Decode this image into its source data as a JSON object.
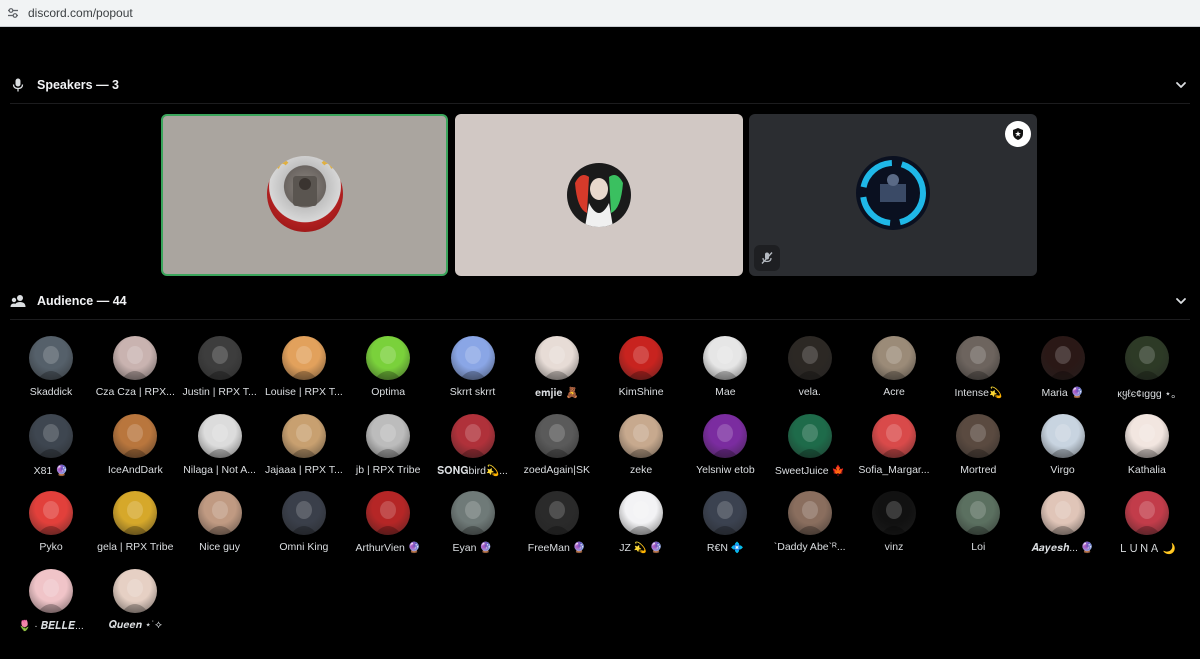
{
  "browser": {
    "url": "discord.com/popout",
    "tune_icon": "site-settings-icon"
  },
  "speakers": {
    "title": "Speakers — 3",
    "icon": "microphone-icon",
    "tiles": [
      {
        "name": "speaker-1",
        "bg": "#aaa59f",
        "border": "#3ba55c",
        "speaking": true
      },
      {
        "name": "speaker-2",
        "bg": "#d1c8c4",
        "border": "none",
        "speaking": false
      },
      {
        "name": "speaker-3",
        "bg": "#2b2d31",
        "border": "none",
        "speaking": false,
        "badge": "moderator-shield-icon",
        "muted": true
      }
    ]
  },
  "audience": {
    "title": "Audience — 44",
    "icon": "people-icon",
    "members": [
      {
        "label": "Skaddick",
        "c": "#55606a"
      },
      {
        "label": "Cza Cza | RPX...",
        "c": "#c9b3b0"
      },
      {
        "label": "Justin | RPX T...",
        "c": "#3d3d3d"
      },
      {
        "label": "Louise | RPX T...",
        "c": "#e2a15c"
      },
      {
        "label": "Optima",
        "c": "#7ad13b"
      },
      {
        "label": "Skrrt skrrt",
        "c": "#8aa6e6"
      },
      {
        "label": "𝐞𝐦𝐣𝐢𝐞 🧸",
        "c": "#e7dcd6"
      },
      {
        "label": "KimShine",
        "c": "#c8231f"
      },
      {
        "label": "Mae",
        "c": "#e6e6e6"
      },
      {
        "label": "vela.",
        "c": "#2c2824"
      },
      {
        "label": "Acre",
        "c": "#9b8b78"
      },
      {
        "label": "Intense💫",
        "c": "#6d645e"
      },
      {
        "label": "Maria 🔮",
        "c": "#2a1816"
      },
      {
        "label": "кყℓє¢ιggg ⋆｡",
        "c": "#2d3a26"
      },
      {
        "label": "X81 🔮",
        "c": "#3e4650"
      },
      {
        "label": "IceAndDark",
        "c": "#b9763d"
      },
      {
        "label": "Nilaga | Not A...",
        "c": "#dcdcdc"
      },
      {
        "label": "Jajaaa | RPX T...",
        "c": "#c8a070"
      },
      {
        "label": "jb | RPX Tribe",
        "c": "#bcbcbc"
      },
      {
        "label": "𝐒𝐎𝐍𝐆bird💫...",
        "c": "#b0313a"
      },
      {
        "label": "zoedAgain|SK",
        "c": "#5a5a5a"
      },
      {
        "label": "zeke",
        "c": "#c7a98e"
      },
      {
        "label": "Yelsniw etob",
        "c": "#7b2ca0"
      },
      {
        "label": "SweetJuice 🍁",
        "c": "#1e6b4a"
      },
      {
        "label": "Sofia_Margar...",
        "c": "#d94a4a"
      },
      {
        "label": "Mortred",
        "c": "#5a4a40"
      },
      {
        "label": "Virgo",
        "c": "#c8d4e0"
      },
      {
        "label": "Kathalia",
        "c": "#f2e6e0"
      },
      {
        "label": "Pyko",
        "c": "#e2403b"
      },
      {
        "label": "gela | RPX Tribe",
        "c": "#d6a82a"
      },
      {
        "label": "Nice guy",
        "c": "#c09a82"
      },
      {
        "label": "Omni King",
        "c": "#3a3f4a"
      },
      {
        "label": "ArthurVien 🔮",
        "c": "#b52626"
      },
      {
        "label": "Eyan 🔮",
        "c": "#6f7a78"
      },
      {
        "label": "FreeMan 🔮",
        "c": "#2a2a2a"
      },
      {
        "label": "JZ 💫 🔮",
        "c": "#f3f3f5"
      },
      {
        "label": "R€N 💠",
        "c": "#3b4250"
      },
      {
        "label": "`Daddy Abe`ᴿ...",
        "c": "#8a6e5e"
      },
      {
        "label": "vinz",
        "c": "#111111"
      },
      {
        "label": "Loi",
        "c": "#5b7060"
      },
      {
        "label": "𝑨𝒂𝒚𝒆𝒔𝒉... 🔮",
        "c": "#e0c5b8"
      },
      {
        "label": "ＬＵＮＡ 🌙",
        "c": "#c23c4a"
      },
      {
        "label": "🌷 · 𝑩𝑬𝑳𝑳𝑬...",
        "c": "#f0c4c8"
      },
      {
        "label": "𝑸𝒖𝒆𝒆𝒏 ⋆˙⟡",
        "c": "#e6d0c4"
      }
    ]
  }
}
